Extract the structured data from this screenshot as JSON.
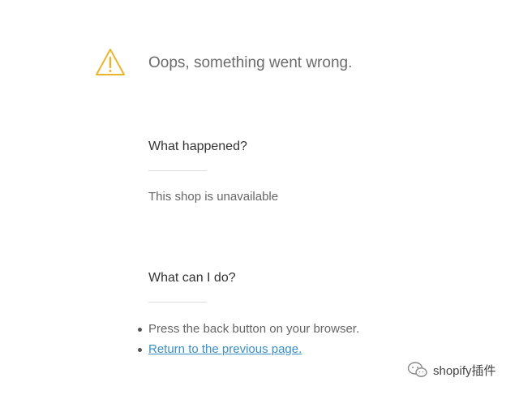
{
  "error": {
    "headline": "Oops, something went wrong.",
    "icon": "warning-triangle-icon",
    "icon_color": "#e8b52c"
  },
  "what_happened": {
    "title": "What happened?",
    "message": "This shop is unavailable"
  },
  "what_can_i_do": {
    "title": "What can I do?",
    "items": [
      {
        "text": "Press the back button on your browser.",
        "is_link": false
      },
      {
        "text": "Return to the previous page.",
        "is_link": true
      }
    ]
  },
  "watermark": {
    "text": "shopify插件"
  },
  "colors": {
    "link": "#3a8fc8",
    "headline": "#6b6b6b",
    "title": "#333333",
    "body": "#666666"
  }
}
